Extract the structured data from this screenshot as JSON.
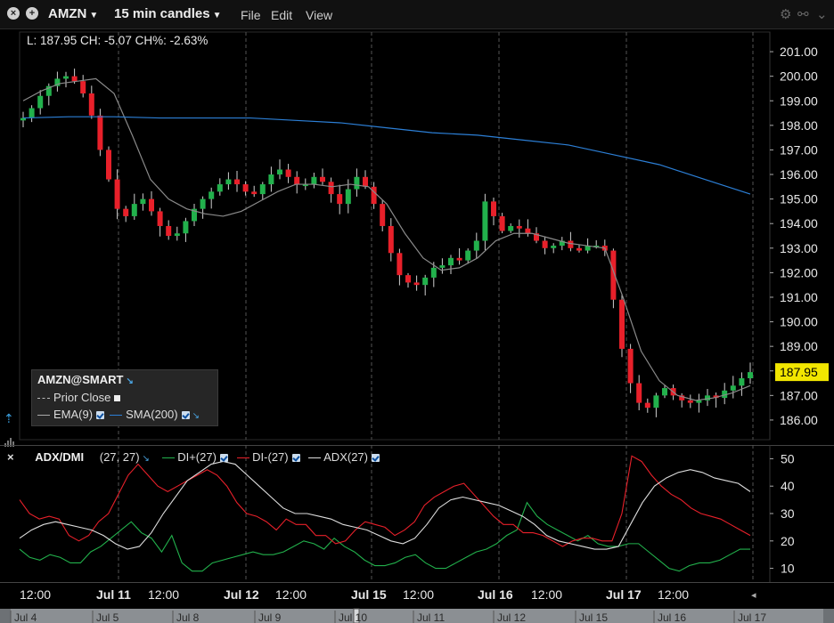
{
  "window": {
    "symbol": "AMZN",
    "timeframe": "15 min candles",
    "menu": [
      "File",
      "Edit",
      "View"
    ]
  },
  "ohlc_readout": "L: 187.95 CH: -5.07 CH%: -2.63%",
  "last_price": "187.95",
  "legend": {
    "title": "AMZN@SMART",
    "prior_close": "Prior Close",
    "ema": "EMA(9)",
    "sma": "SMA(200)"
  },
  "adx_panel": {
    "title": "ADX/DMI",
    "params": "(27, 27)",
    "di_plus": "DI+(27)",
    "di_minus": "DI-(27)",
    "adx": "ADX(27)"
  },
  "colors": {
    "up": "#22b14c",
    "down": "#e8202a",
    "ema": "#8a8a8a",
    "sma": "#2c7fd6",
    "di_plus": "#22b14c",
    "di_minus": "#e8202a",
    "adx": "#dddddd",
    "last_price_bg": "#f2e600"
  },
  "time_axis": {
    "labels": [
      "12:00",
      "Jul 11",
      "12:00",
      "Jul 12",
      "12:00",
      "Jul 15",
      "12:00",
      "Jul 16",
      "12:00",
      "Jul 17",
      "12:00"
    ]
  },
  "navigator": {
    "labels": [
      "Jul 4",
      "Jul 5",
      "Jul 8",
      "Jul 9",
      "Jul 10",
      "Jul 11",
      "Jul 12",
      "Jul 15",
      "Jul 16",
      "Jul 17"
    ]
  },
  "chart_data": [
    {
      "type": "candlestick",
      "title": "AMZN 15 min candles",
      "ylim": [
        185.2,
        201.8
      ],
      "y_ticks": [
        "201.00",
        "200.00",
        "199.00",
        "198.00",
        "197.00",
        "196.00",
        "195.00",
        "194.00",
        "193.00",
        "192.00",
        "191.00",
        "190.00",
        "189.00",
        "188.00",
        "187.00",
        "186.00"
      ],
      "x": [
        "Jul 10",
        "Jul 11",
        "Jul 12",
        "Jul 15",
        "Jul 16",
        "Jul 17"
      ],
      "close_path": [
        198.3,
        198.7,
        199.2,
        199.6,
        199.9,
        200.0,
        199.8,
        199.3,
        198.4,
        197.0,
        195.8,
        194.6,
        194.3,
        194.8,
        195.0,
        194.5,
        193.9,
        193.5,
        193.6,
        194.1,
        194.6,
        195.0,
        195.3,
        195.6,
        195.8,
        195.6,
        195.3,
        195.2,
        195.6,
        196.0,
        196.2,
        195.9,
        195.6,
        195.6,
        195.9,
        195.7,
        195.2,
        194.8,
        195.4,
        195.9,
        195.5,
        194.8,
        193.9,
        192.8,
        191.9,
        191.6,
        191.5,
        191.8,
        192.2,
        192.3,
        192.6,
        192.5,
        192.9,
        193.3,
        194.9,
        194.3,
        193.7,
        193.9,
        193.8,
        193.6,
        193.3,
        193.0,
        193.1,
        193.3,
        193.0,
        192.9,
        193.1,
        193.1,
        192.9,
        190.9,
        188.9,
        187.5,
        186.7,
        186.5,
        187.0,
        187.3,
        187.0,
        186.8,
        186.7,
        186.8,
        187.0,
        186.9,
        187.2,
        187.4,
        187.7,
        187.95
      ],
      "series": [
        {
          "name": "EMA(9)",
          "values": [
            199.0,
            199.4,
            199.7,
            199.8,
            199.9,
            199.3,
            197.6,
            195.8,
            195.0,
            194.6,
            194.4,
            194.3,
            194.5,
            194.9,
            195.3,
            195.6,
            195.6,
            195.5,
            195.6,
            195.5,
            194.8,
            193.6,
            192.6,
            192.1,
            192.2,
            192.6,
            193.3,
            193.6,
            193.6,
            193.4,
            193.2,
            193.1,
            193.0,
            191.0,
            188.8,
            187.6,
            187.0,
            186.8,
            186.9,
            187.1,
            187.4
          ]
        },
        {
          "name": "SMA(200)",
          "values": [
            198.3,
            198.35,
            198.35,
            198.3,
            198.3,
            198.3,
            198.2,
            198.1,
            197.9,
            197.7,
            197.6,
            197.4,
            197.2,
            196.8,
            196.4,
            195.8,
            195.2
          ]
        },
        {
          "name": "Prior Close",
          "values": []
        }
      ]
    },
    {
      "type": "line",
      "title": "ADX/DMI (27, 27)",
      "ylim": [
        5,
        55
      ],
      "y_ticks": [
        "50",
        "40",
        "30",
        "20",
        "10"
      ],
      "series": [
        {
          "name": "DI+(27)",
          "values": [
            17,
            14,
            13,
            15,
            14,
            12,
            12,
            16,
            18,
            21,
            24,
            27,
            23,
            21,
            16,
            22,
            12,
            9,
            9,
            12,
            13,
            14,
            15,
            16,
            15,
            15,
            16,
            18,
            20,
            19,
            17,
            21,
            18,
            16,
            13,
            11,
            11,
            12,
            14,
            15,
            12,
            10,
            10,
            12,
            14,
            16,
            17,
            19,
            22,
            24,
            34,
            29,
            26,
            24,
            22,
            20,
            22,
            19,
            18,
            18,
            19,
            19,
            16,
            13,
            10,
            9,
            11,
            12,
            12,
            13,
            15,
            17,
            17
          ]
        },
        {
          "name": "DI-(27)",
          "values": [
            35,
            30,
            28,
            29,
            28,
            22,
            20,
            22,
            27,
            30,
            37,
            44,
            48,
            44,
            40,
            38,
            40,
            42,
            44,
            46,
            44,
            40,
            34,
            30,
            29,
            27,
            24,
            28,
            26,
            26,
            22,
            22,
            19,
            20,
            24,
            27,
            26,
            25,
            22,
            24,
            27,
            33,
            36,
            38,
            40,
            41,
            37,
            33,
            29,
            26,
            26,
            23,
            23,
            22,
            20,
            18,
            20,
            21,
            21,
            20,
            20,
            30,
            51,
            49,
            44,
            40,
            37,
            35,
            32,
            30,
            29,
            28,
            26,
            24,
            22
          ]
        },
        {
          "name": "ADX(27)",
          "values": [
            21,
            24,
            26,
            27,
            26,
            25,
            24,
            22,
            19,
            17,
            18,
            23,
            30,
            36,
            42,
            45,
            48,
            49,
            48,
            44,
            40,
            36,
            32,
            30,
            30,
            29,
            28,
            26,
            25,
            24,
            22,
            20,
            19,
            21,
            26,
            32,
            35,
            36,
            35,
            34,
            33,
            31,
            29,
            26,
            22,
            20,
            19,
            18,
            17,
            17,
            18,
            26,
            34,
            40,
            43,
            45,
            46,
            45,
            43,
            42,
            41,
            38
          ]
        }
      ]
    }
  ]
}
